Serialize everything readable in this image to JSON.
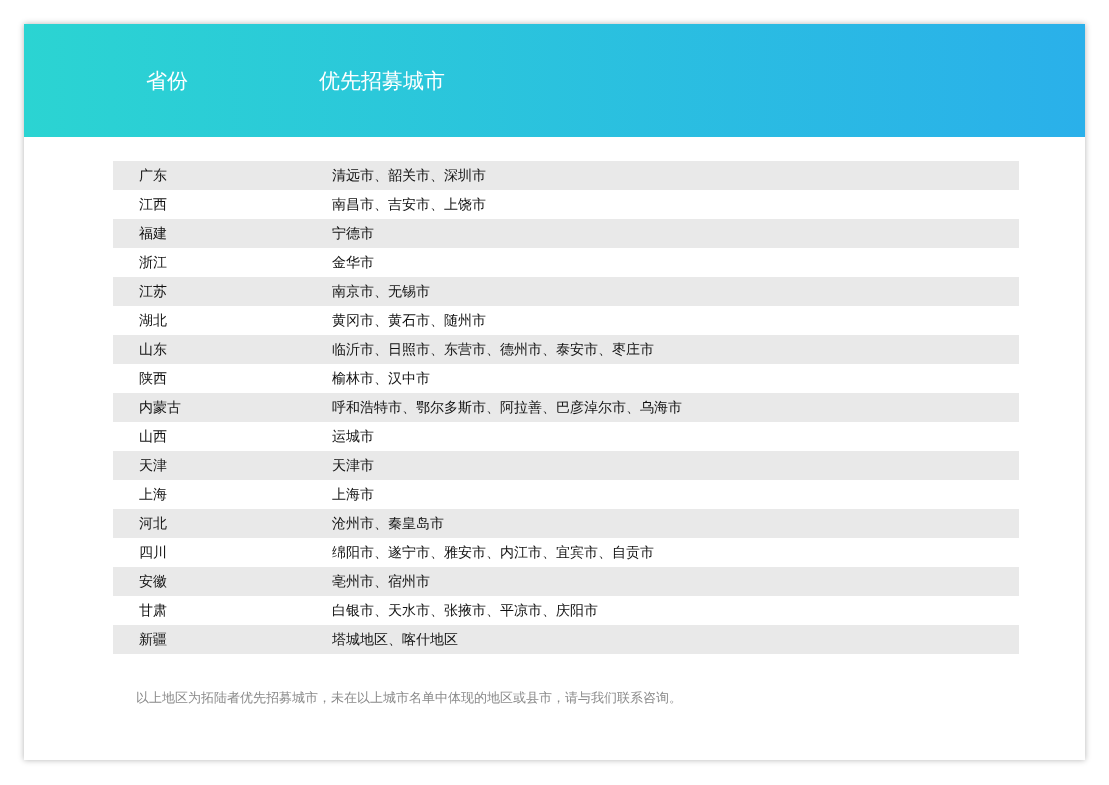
{
  "table": {
    "columns": [
      "省份",
      "优先招募城市"
    ],
    "rows": [
      {
        "province": "广东",
        "cities": "清远市、韶关市、深圳市"
      },
      {
        "province": "江西",
        "cities": "南昌市、吉安市、上饶市"
      },
      {
        "province": "福建",
        "cities": "宁德市"
      },
      {
        "province": "浙江",
        "cities": "金华市"
      },
      {
        "province": "江苏",
        "cities": "南京市、无锡市"
      },
      {
        "province": "湖北",
        "cities": "黄冈市、黄石市、随州市"
      },
      {
        "province": "山东",
        "cities": "临沂市、日照市、东营市、德州市、泰安市、枣庄市"
      },
      {
        "province": "陕西",
        "cities": "榆林市、汉中市"
      },
      {
        "province": "内蒙古",
        "cities": "呼和浩特市、鄂尔多斯市、阿拉善、巴彦淖尔市、乌海市"
      },
      {
        "province": "山西",
        "cities": "运城市"
      },
      {
        "province": "天津",
        "cities": "天津市"
      },
      {
        "province": "上海",
        "cities": "上海市"
      },
      {
        "province": "河北",
        "cities": "沧州市、秦皇岛市"
      },
      {
        "province": "四川",
        "cities": "绵阳市、遂宁市、雅安市、内江市、宜宾市、自贡市"
      },
      {
        "province": "安徽",
        "cities": "亳州市、宿州市"
      },
      {
        "province": "甘肃",
        "cities": "白银市、天水市、张掖市、平凉市、庆阳市"
      },
      {
        "province": "新疆",
        "cities": "塔城地区、喀什地区"
      }
    ]
  },
  "footnote": "以上地区为拓陆者优先招募城市，未在以上城市名单中体现的地区或县市，请与我们联系咨询。"
}
